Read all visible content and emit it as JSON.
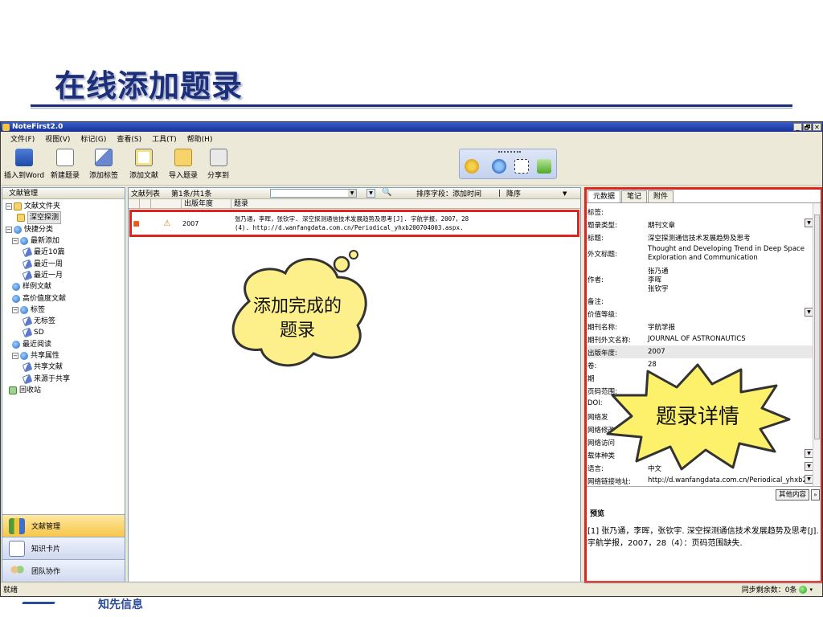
{
  "slide": {
    "title": "在线添加题录"
  },
  "window": {
    "title": "NoteFirst2.0",
    "controls": [
      "_",
      "🗗",
      "✕"
    ]
  },
  "menu": [
    "文件(F)",
    "视图(V)",
    "标记(G)",
    "查看(S)",
    "工具(T)",
    "帮助(H)"
  ],
  "toolbar": [
    "插入到Word",
    "新建题录",
    "添加标签",
    "添加文献",
    "导入题录",
    "分享到"
  ],
  "left_panel": {
    "header": "文献管理",
    "tree": [
      {
        "label": "文献文件夹",
        "icon": "folder-icon",
        "exp": "−"
      },
      {
        "label": "深空探测",
        "icon": "folder-icon",
        "selected": true
      },
      {
        "label": "快捷分类",
        "icon": "globe-icon",
        "exp": "−"
      },
      {
        "label": "最新添加",
        "icon": "globe-icon",
        "exp": "−"
      },
      {
        "label": "最近10篇",
        "icon": "tag-icon"
      },
      {
        "label": "最近一周",
        "icon": "tag-icon"
      },
      {
        "label": "最近一月",
        "icon": "tag-icon"
      },
      {
        "label": "样例文献",
        "icon": "globe-icon"
      },
      {
        "label": "高价值度文献",
        "icon": "globe-icon"
      },
      {
        "label": "标签",
        "icon": "globe-icon",
        "exp": "−"
      },
      {
        "label": "无标签",
        "icon": "tag-icon"
      },
      {
        "label": "SD",
        "icon": "tag-icon"
      },
      {
        "label": "最近阅读",
        "icon": "globe-icon"
      },
      {
        "label": "共享属性",
        "icon": "globe-icon",
        "exp": "−"
      },
      {
        "label": "共享文献",
        "icon": "tag-icon"
      },
      {
        "label": "来源于共享",
        "icon": "tag-icon"
      },
      {
        "label": "回收站",
        "icon": "bin-icon"
      }
    ],
    "nav": [
      "文献管理",
      "知识卡片",
      "团队协作"
    ]
  },
  "middle_panel": {
    "header": "文献列表",
    "page_info": "第1条/共1条",
    "sort_label": "排序字段：添加时间",
    "sort_order": "降序",
    "columns": [
      "",
      "",
      "",
      "出版年度",
      "题录"
    ],
    "rows": [
      {
        "year": "2007",
        "title_line1": "张乃通，李晖，张钦宇. 深空探测通信技术发展趋势及思考[J]. 宇航学报，2007，28",
        "title_line2": "(4). http://d.wanfangdata.com.cn/Periodical_yhxb200704003.aspx."
      }
    ]
  },
  "right_panel": {
    "tabs": [
      "元数据",
      "笔记",
      "附件"
    ],
    "meta": [
      {
        "k": "标签:",
        "v": ""
      },
      {
        "k": "题录类型:",
        "v": "期刊文章",
        "dd": true
      },
      {
        "k": "标题:",
        "v": "深空探测通信技术发展趋势及思考"
      },
      {
        "k": "外文标题:",
        "v": "Thought and Developing Trend in Deep Space",
        "v2": "Exploration and Communication"
      },
      {
        "k": "作者:",
        "v": "张乃通",
        "v2": "李晖",
        "v3": "张钦宇"
      },
      {
        "k": "备注:",
        "v": ""
      },
      {
        "k": "价值等级:",
        "v": "",
        "dd": true
      },
      {
        "k": "期刊名称:",
        "v": "宇航学报"
      },
      {
        "k": "期刊外文名称:",
        "v": "JOURNAL OF ASTRONAUTICS"
      },
      {
        "k": "出版年度:",
        "v": "2007"
      },
      {
        "k": "卷:",
        "v": "28"
      },
      {
        "k": "期",
        "v": ""
      },
      {
        "k": "页码范围:",
        "v": ""
      },
      {
        "k": "DOI:",
        "v": ""
      },
      {
        "k": "网络发",
        "v": ""
      },
      {
        "k": "网络修改",
        "v": ""
      },
      {
        "k": "网络访问",
        "v": ""
      },
      {
        "k": "载体种类",
        "v": "",
        "dd": true
      },
      {
        "k": "语言:",
        "v": "中文",
        "dd": true
      },
      {
        "k": "网络链接地址:",
        "v": "http://d.wanfangdata.com.cn/Periodical_yhxb20",
        "dd": true
      }
    ],
    "more_button": "其他内容",
    "preview_header": "预览",
    "preview_text": "[1] 张乃通，李晖，张钦宇. 深空探测通信技术发展趋势及思考[J]. 宇航学报，2007，28（4）：页码范围缺失."
  },
  "status": {
    "left": "就绪",
    "right": "同步剩余数：0条"
  },
  "callouts": {
    "cloud": "添加完成的题录",
    "burst": "题录详情"
  },
  "footer": {
    "logo_text": "知先信息"
  },
  "colors": {
    "title": "#1c2f7a",
    "highlight": "#e0241c",
    "cloud_fill": "#fdf08a",
    "burst_fill": "#fdf06a"
  }
}
